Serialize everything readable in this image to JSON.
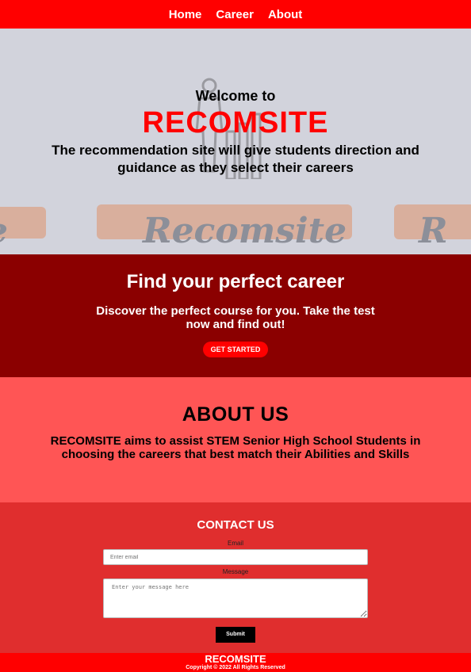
{
  "nav": {
    "items": [
      "Home",
      "Career",
      "About"
    ]
  },
  "hero": {
    "welcome": "Welcome to",
    "brand": "RECOMSITE",
    "tagline": "The recommendation site will give students direction and guidance as they select their careers",
    "watermark": "Recomsite"
  },
  "career": {
    "title": "Find your perfect career",
    "text": "Discover the perfect course for you. Take the test now and find out!",
    "button": "GET STARTED"
  },
  "about": {
    "title": "ABOUT US",
    "text": "RECOMSITE aims to assist STEM Senior High School Students in choosing the careers that best match their Abilities and Skills"
  },
  "contact": {
    "title": "CONTACT US",
    "email_label": "Email",
    "email_placeholder": "Enter email",
    "message_label": "Message",
    "message_placeholder": "Enter your message here",
    "submit": "Submit"
  },
  "footer": {
    "brand": "RECOMSITE",
    "copyright": "Copyright © 2022 All Rights Reserved"
  },
  "colors": {
    "nav": "#ff0000",
    "career_bg": "#8b0000",
    "about_bg": "#ff5555",
    "contact_bg": "#e02e2e",
    "brand_red": "#ff0000"
  }
}
